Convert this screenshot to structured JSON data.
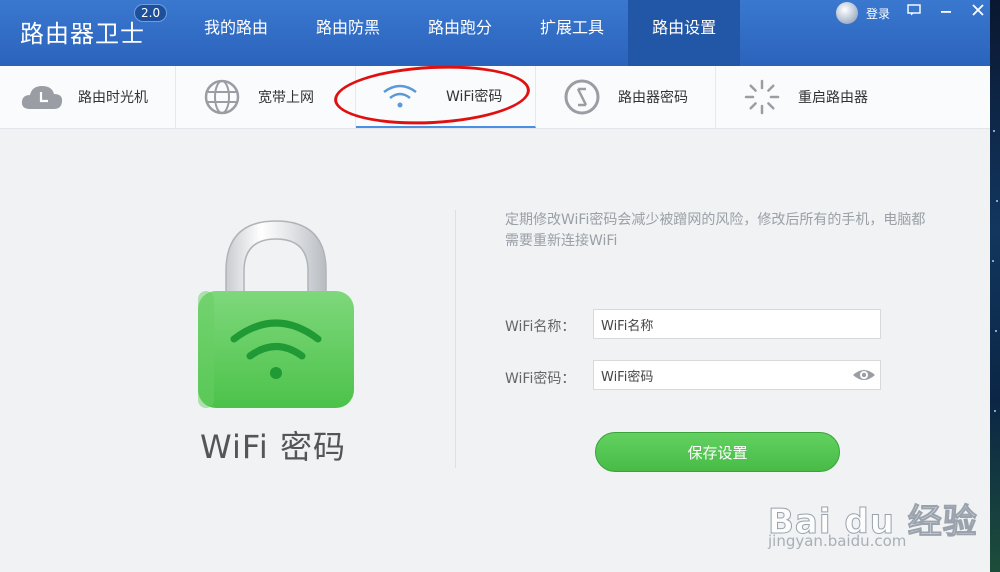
{
  "app": {
    "title": "路由器卫士",
    "version": "2.0"
  },
  "nav": {
    "items": [
      "我的路由",
      "路由防黑",
      "路由跑分",
      "扩展工具",
      "路由设置"
    ],
    "active": "路由设置"
  },
  "window": {
    "login_label": "登录"
  },
  "subtabs": [
    {
      "label": "路由时光机",
      "icon": "cloud-clock-icon"
    },
    {
      "label": "宽带上网",
      "icon": "globe-icon"
    },
    {
      "label": "WiFi密码",
      "icon": "wifi-icon"
    },
    {
      "label": "路由器密码",
      "icon": "lock-circle-icon"
    },
    {
      "label": "重启路由器",
      "icon": "spinner-icon"
    }
  ],
  "content": {
    "hero_title": "WiFi 密码",
    "notice": "定期修改WiFi密码会减少被蹭网的风险，修改后所有的手机，电脑都需要重新连接WiFi",
    "fields": {
      "name_label": "WiFi名称：",
      "name_value": "WiFi名称",
      "password_label": "WiFi密码：",
      "password_value": "WiFi密码"
    },
    "save_label": "保存设置"
  },
  "watermark": {
    "main": "Bai du 经验",
    "sub": "jingyan.baidu.com"
  },
  "colors": {
    "header": "#2b63bb",
    "active_nav": "#2256a6",
    "accent_green": "#4cc24a",
    "annotation_red": "#e01010"
  }
}
